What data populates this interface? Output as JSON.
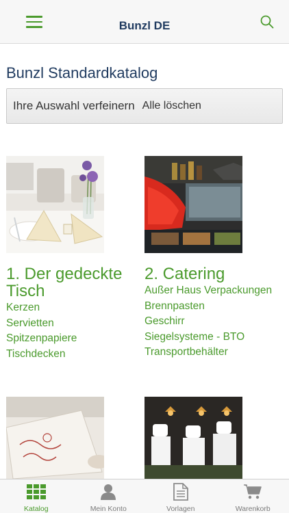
{
  "header": {
    "title": "Bunzl DE"
  },
  "catalog": {
    "title": "Bunzl Standardkatalog"
  },
  "filter": {
    "label": "Ihre Auswahl verfeinern",
    "clear": "Alle löschen"
  },
  "categories": [
    {
      "title": "1. Der gedeckte Tisch",
      "items": [
        "Kerzen",
        "Servietten",
        "Spitzenpapiere",
        "Tischdecken"
      ]
    },
    {
      "title": "2. Catering",
      "items": [
        "Außer Haus Verpackungen",
        "Brennpasten",
        "Geschirr",
        "Siegelsysteme - BTO",
        "Transportbehälter"
      ]
    }
  ],
  "tabs": [
    {
      "label": "Katalog",
      "icon": "grid-icon",
      "active": true
    },
    {
      "label": "Mein Konto",
      "icon": "person-icon",
      "active": false
    },
    {
      "label": "Vorlagen",
      "icon": "document-icon",
      "active": false
    },
    {
      "label": "Warenkorb",
      "icon": "cart-icon",
      "active": false
    }
  ],
  "colors": {
    "accent": "#4a9a2c",
    "title": "#1f3a5f",
    "tab_inactive": "#7a7a7a"
  }
}
